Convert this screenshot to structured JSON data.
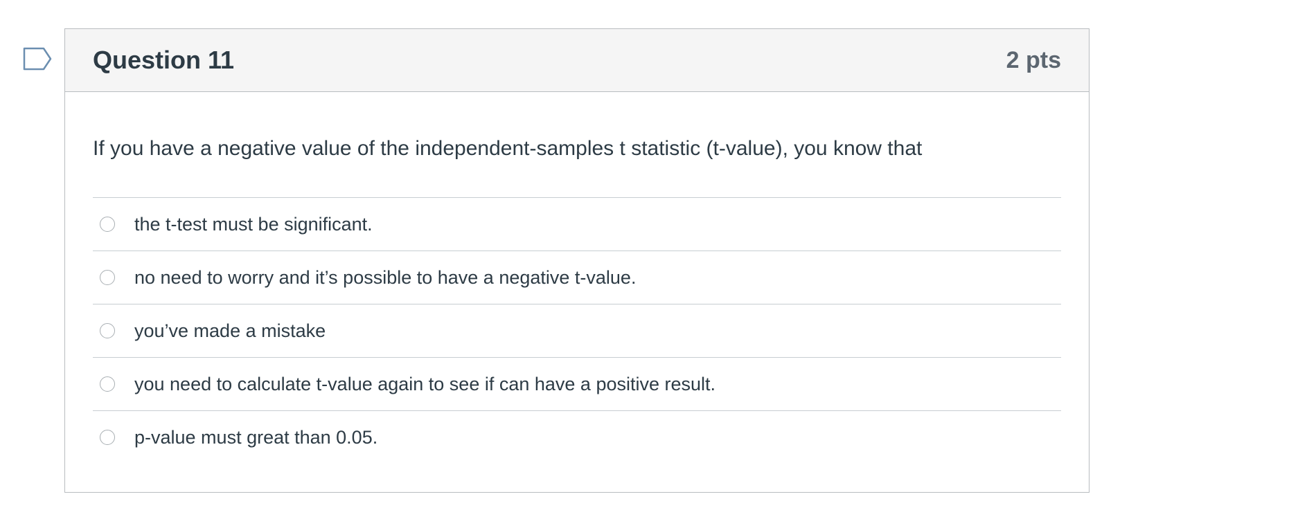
{
  "question": {
    "title": "Question 11",
    "points": "2 pts",
    "text": "If you have a negative value of the independent-samples t statistic (t-value), you know that",
    "flag_icon": "flag-bookmark-icon",
    "answers": [
      {
        "label": "the t-test must be significant.",
        "selected": false
      },
      {
        "label": "no need to worry and it’s possible to have a negative t-value.",
        "selected": false
      },
      {
        "label": "you’ve made a mistake",
        "selected": false
      },
      {
        "label": "you need to calculate t-value again to see if can have a positive result.",
        "selected": false
      },
      {
        "label": "p-value must great than 0.05.",
        "selected": false
      }
    ]
  },
  "colors": {
    "header_bg": "#f5f5f5",
    "border": "#b8bcbf",
    "text": "#2d3b45",
    "points_text": "#5c6670",
    "flag_stroke": "#6b8eb0"
  }
}
